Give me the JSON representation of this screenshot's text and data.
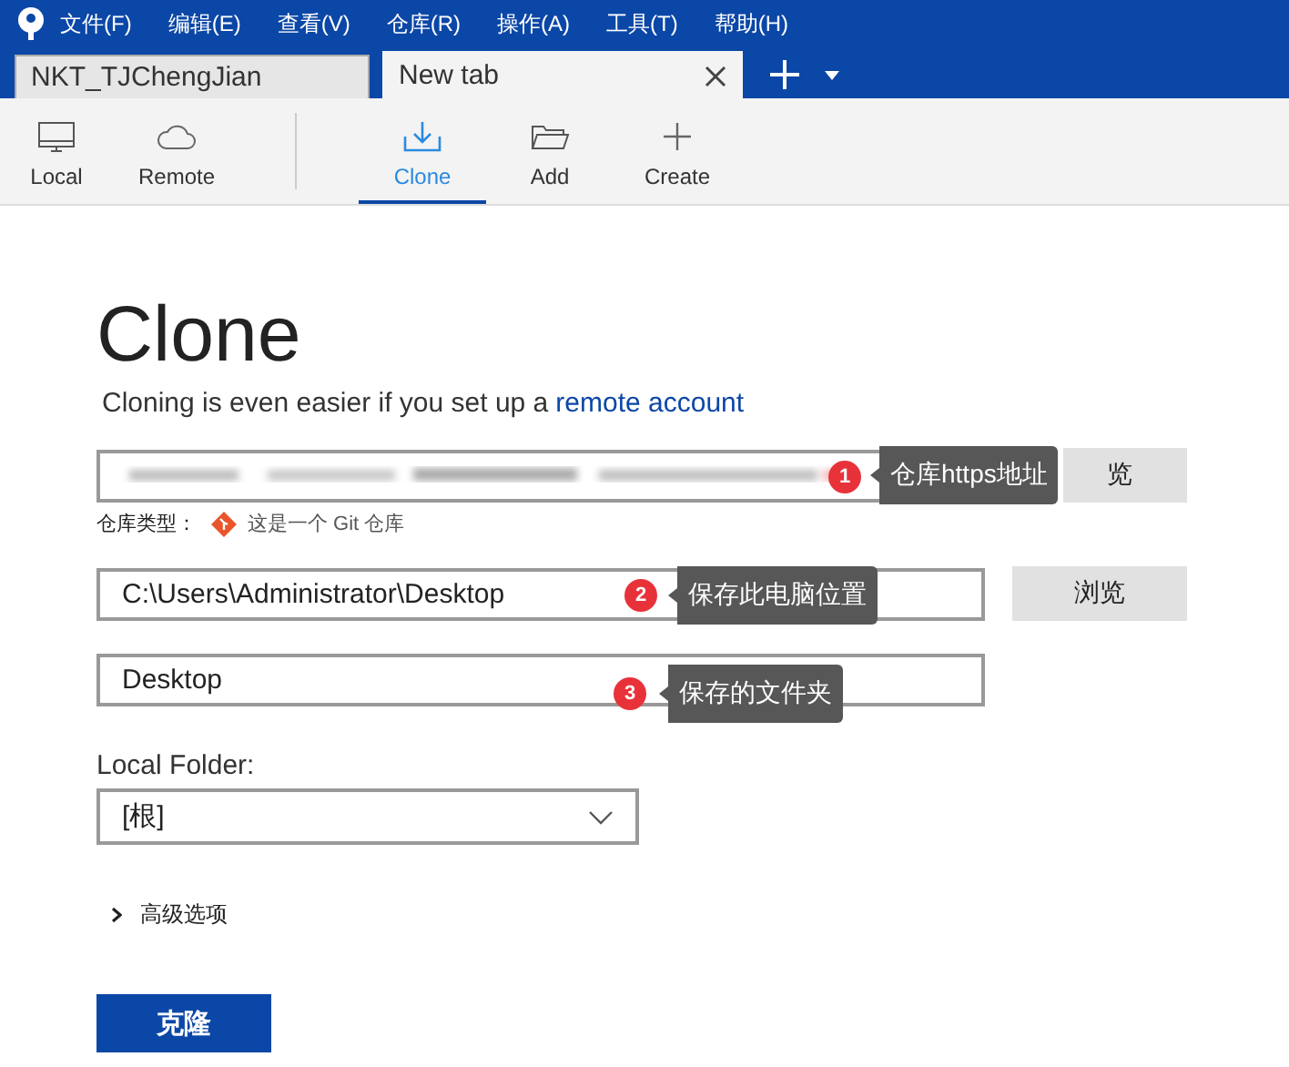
{
  "menu_bar": {
    "items": [
      "文件(F)",
      "编辑(E)",
      "查看(V)",
      "仓库(R)",
      "操作(A)",
      "工具(T)",
      "帮助(H)"
    ]
  },
  "tabs": [
    {
      "label": "NKT_TJChengJian",
      "selected": false
    },
    {
      "label": "New tab",
      "selected": true
    }
  ],
  "toolbar": {
    "groups": [
      [
        {
          "label": "Local",
          "selected": false
        },
        {
          "label": "Remote",
          "selected": false
        }
      ],
      [
        {
          "label": "Clone",
          "selected": true
        },
        {
          "label": "Add",
          "selected": false
        },
        {
          "label": "Create",
          "selected": false
        }
      ]
    ]
  },
  "clone_page": {
    "title": "Clone",
    "subtitle": {
      "text": "Cloning is even easier if you set up a",
      "link": "remote account"
    },
    "source_field": {
      "browse_button": "览"
    },
    "repo_type": {
      "label": "仓库类型：",
      "value": "这是一个 Git 仓库"
    },
    "destination_field": {
      "value": "C:\\Users\\Administrator\\Desktop",
      "browse_button": "浏览"
    },
    "name_field": {
      "value": "Desktop"
    },
    "local_folder": {
      "label": "Local Folder:",
      "value": "[根]"
    },
    "advanced": {
      "label": "高级选项",
      "expanded": false
    },
    "clone_button": "克隆"
  },
  "annotations": [
    {
      "number": "1",
      "text": "仓库https地址"
    },
    {
      "number": "2",
      "text": "保存此电脑位置"
    },
    {
      "number": "3",
      "text": "保存的文件夹"
    }
  ]
}
